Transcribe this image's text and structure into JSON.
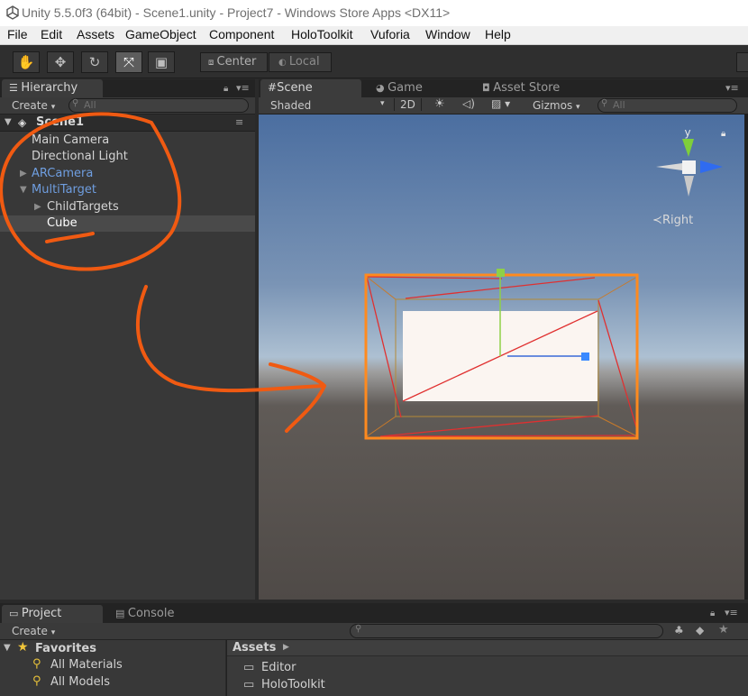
{
  "window": {
    "title": "Unity 5.5.0f3 (64bit) - Scene1.unity - Project7 - Windows Store Apps <DX11>",
    "logo_icon": "unity-logo-icon"
  },
  "menubar": {
    "items": [
      "File",
      "Edit",
      "Assets",
      "GameObject",
      "Component",
      "HoloToolkit",
      "Vuforia",
      "Window",
      "Help"
    ]
  },
  "toolbar": {
    "tools": [
      {
        "name": "hand-tool",
        "icon": "hand-icon",
        "glyph": "✋",
        "active": false
      },
      {
        "name": "move-tool",
        "icon": "move-arrows-icon",
        "glyph": "✥",
        "active": false
      },
      {
        "name": "rotate-tool",
        "icon": "rotate-icon",
        "glyph": "↻",
        "active": false
      },
      {
        "name": "scale-tool",
        "icon": "scale-icon",
        "glyph": "⤧",
        "active": true
      },
      {
        "name": "rect-tool",
        "icon": "rect-transform-icon",
        "glyph": "▣",
        "active": false
      }
    ],
    "pivot_mode": "Center",
    "pivot_rotation": "Local"
  },
  "hierarchy": {
    "tab_label": "Hierarchy",
    "create_label": "Create",
    "search_placeholder": "All",
    "scene_name": "Scene1",
    "items": [
      {
        "label": "Main Camera",
        "indent": 0,
        "expand": "",
        "color": "default",
        "selected": false
      },
      {
        "label": "Directional Light",
        "indent": 0,
        "expand": "",
        "color": "default",
        "selected": false
      },
      {
        "label": "ARCamera",
        "indent": 0,
        "expand": "▶",
        "color": "blue",
        "selected": false
      },
      {
        "label": "MultiTarget",
        "indent": 0,
        "expand": "▼",
        "color": "blue",
        "selected": false
      },
      {
        "label": "ChildTargets",
        "indent": 1,
        "expand": "▶",
        "color": "default",
        "selected": false
      },
      {
        "label": "Cube",
        "indent": 1,
        "expand": "",
        "color": "default",
        "selected": true
      }
    ]
  },
  "scene_panel": {
    "tabs": [
      {
        "label": "Scene",
        "icon": "grid-icon",
        "active": true
      },
      {
        "label": "Game",
        "icon": "pacman-icon",
        "active": false
      },
      {
        "label": "Asset Store",
        "icon": "shopping-bag-icon",
        "active": false
      }
    ],
    "draw_mode": "Shaded",
    "mode_2d": "2D",
    "gizmos_label": "Gizmos",
    "search_placeholder": "All",
    "gizmo_axis_y": "y",
    "view_label": "Right"
  },
  "bottom": {
    "tabs": [
      {
        "label": "Project",
        "icon": "folder-icon",
        "active": true
      },
      {
        "label": "Console",
        "icon": "console-icon",
        "active": false
      }
    ],
    "create_label": "Create",
    "favorites_label": "Favorites",
    "favorites": [
      "All Materials",
      "All Models"
    ],
    "assets_breadcrumb": "Assets",
    "asset_folders": [
      "Editor",
      "HoloToolkit"
    ]
  },
  "colors": {
    "annotation_orange": "#f05a12",
    "selection_orange": "#ff8a1e",
    "hierarchy_blue": "#6f9ee0"
  }
}
